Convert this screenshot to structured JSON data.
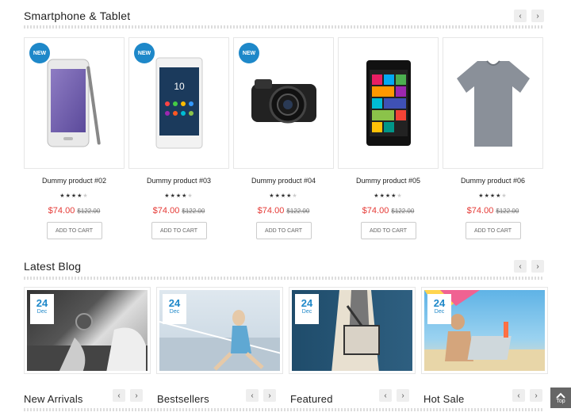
{
  "smartphone_section": {
    "title": "Smartphone & Tablet"
  },
  "products": [
    {
      "name": "Dummy product #02",
      "badge": "NEW",
      "price": "$74.00",
      "old_price": "$122.00",
      "cta": "ADD TO CART",
      "rating": 4,
      "image": "smartphone-galaxy-note"
    },
    {
      "name": "Dummy product #03",
      "badge": "NEW",
      "price": "$74.00",
      "old_price": "$122.00",
      "cta": "ADD TO CART",
      "rating": 4,
      "image": "smartphone-xperia"
    },
    {
      "name": "Dummy product #04",
      "badge": "NEW",
      "price": "$74.00",
      "old_price": "$122.00",
      "cta": "ADD TO CART",
      "rating": 4,
      "image": "camera"
    },
    {
      "name": "Dummy product #05",
      "badge": "",
      "price": "$74.00",
      "old_price": "$122.00",
      "cta": "ADD TO CART",
      "rating": 4,
      "image": "lumia-phone"
    },
    {
      "name": "Dummy product #06",
      "badge": "",
      "price": "$74.00",
      "old_price": "$122.00",
      "cta": "ADD TO CART",
      "rating": 4,
      "image": "tshirt"
    }
  ],
  "blog_section": {
    "title": "Latest Blog"
  },
  "blogs": [
    {
      "day": "24",
      "month": "Dec",
      "image": "watch-wrist"
    },
    {
      "day": "24",
      "month": "Dec",
      "image": "woman-sitting"
    },
    {
      "day": "24",
      "month": "Dec",
      "image": "bag-fashion"
    },
    {
      "day": "24",
      "month": "Dec",
      "image": "beach-laptop"
    }
  ],
  "bottom_tabs": [
    {
      "title": "New Arrivals"
    },
    {
      "title": "Bestsellers"
    },
    {
      "title": "Featured"
    },
    {
      "title": "Hot Sale"
    }
  ],
  "top_button": {
    "label": "Top"
  },
  "colors": {
    "accent": "#1e88c9",
    "price": "#e53935"
  }
}
